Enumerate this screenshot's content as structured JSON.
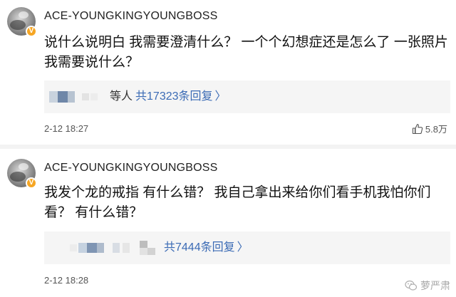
{
  "comments": [
    {
      "username": "ACE-YOUNGKINGYOUNGBOSS",
      "badge": "V",
      "text": "说什么说明白 我需要澄清什么？ 一个个幻想症还是怎么了 一张照片我需要说什么？",
      "reply_by": "等人",
      "reply_count": "共17323条回复",
      "timestamp": "2-12 18:27",
      "likes": "5.8万"
    },
    {
      "username": "ACE-YOUNGKINGYOUNGBOSS",
      "badge": "V",
      "text": "我发个龙的戒指 有什么错？ 我自己拿出来给你们看手机我怕你们看？ 有什么错？",
      "reply_count": "共7444条回复",
      "timestamp": "2-12 18:28"
    }
  ],
  "icons": {
    "verified": "verified-badge-icon",
    "like": "thumbs-up-icon",
    "chevron": "chevron-right-icon",
    "watermark": "wechat-icon"
  },
  "watermark_text": "萝严肃",
  "colors": {
    "link": "#3b6bb5",
    "badge": "#f6a623",
    "reply_bg": "#f5f5f5"
  }
}
